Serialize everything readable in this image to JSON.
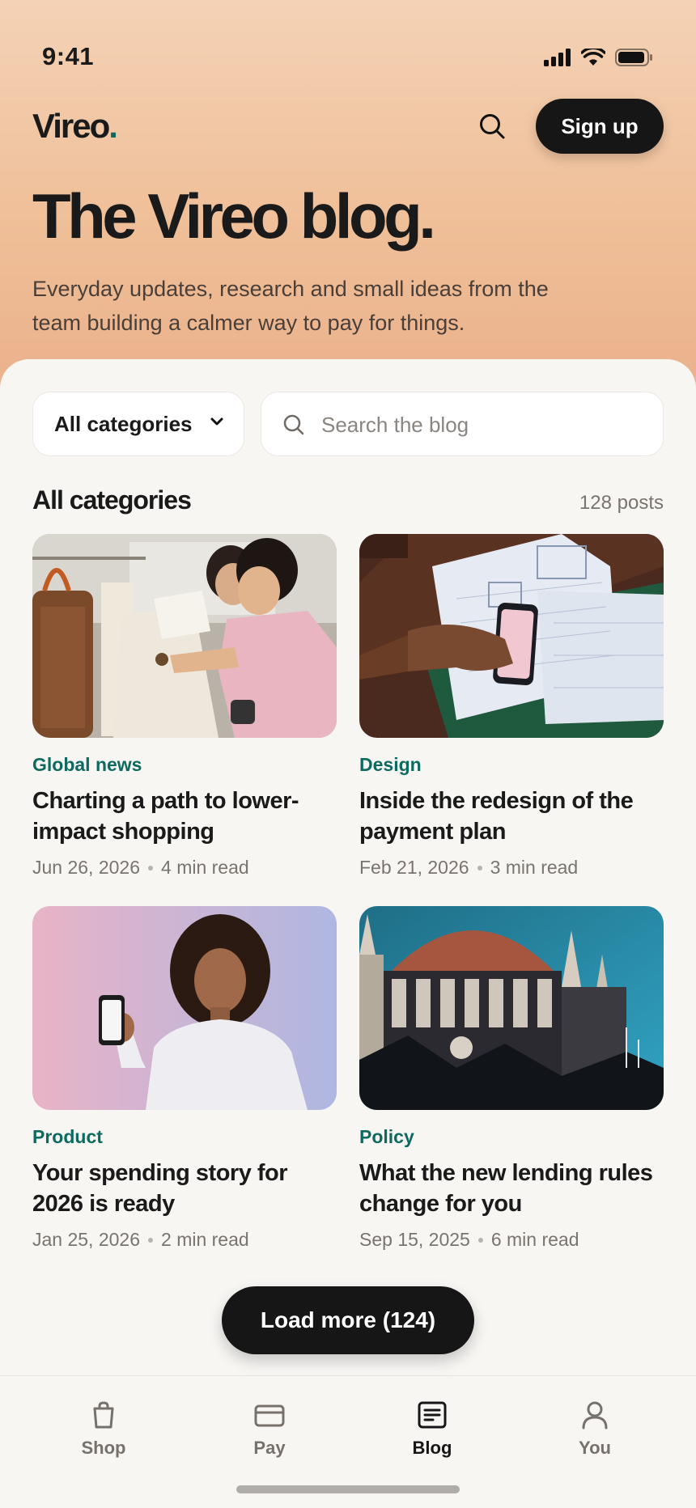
{
  "status": {
    "time": "9:41"
  },
  "header": {
    "logo": "Vireo",
    "logo_dot": ".",
    "signup": "Sign up"
  },
  "hero": {
    "title": "The Vireo blog.",
    "subtitle": "Everyday updates, research and small ideas from the team building a calmer way to pay for things."
  },
  "filters": {
    "category": "All categories",
    "search_placeholder": "Search the blog"
  },
  "section": {
    "title": "All categories",
    "count": "128 posts"
  },
  "posts": [
    {
      "category": "Global news",
      "title": "Charting a path to lower-impact shopping",
      "date": "Jun 26, 2026",
      "read": "4 min read",
      "image": "shopping-tote-photo"
    },
    {
      "category": "Design",
      "title": "Inside the redesign of the payment plan",
      "date": "Feb 21, 2026",
      "read": "3 min read",
      "image": "phone-wireframes-photo"
    },
    {
      "category": "Product",
      "title": "Your spending story for 2026 is ready",
      "date": "Jan 25, 2026",
      "read": "2 min read",
      "image": "woman-phone-photo"
    },
    {
      "category": "Policy",
      "title": "What the new lending rules change for you",
      "date": "Sep 15, 2025",
      "read": "6 min read",
      "image": "parliament-building-photo"
    }
  ],
  "load_more": "Load more (124)",
  "tabs": [
    {
      "label": "Shop",
      "icon": "bag-icon"
    },
    {
      "label": "Pay",
      "icon": "card-icon"
    },
    {
      "label": "Blog",
      "icon": "article-icon",
      "active": true
    },
    {
      "label": "You",
      "icon": "person-icon"
    }
  ],
  "colors": {
    "accent": "#0e6a5e",
    "dark": "#161616",
    "hero_top": "#f4d2b6",
    "hero_bottom": "#eab08a"
  }
}
